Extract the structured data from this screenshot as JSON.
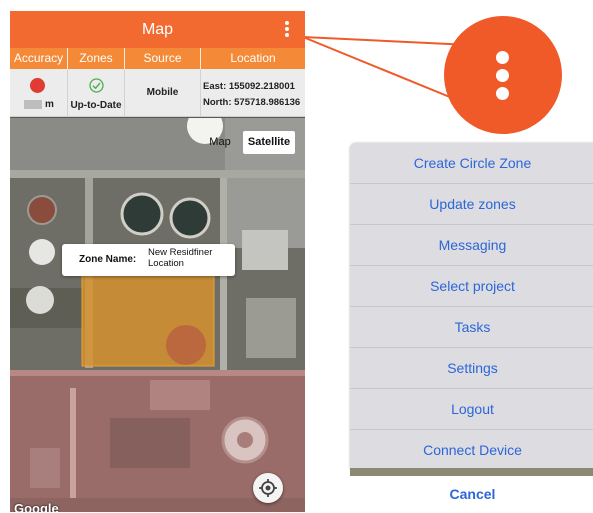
{
  "app": {
    "title": "Map"
  },
  "info": {
    "headers": [
      "Accuracy",
      "Zones",
      "Source",
      "Location"
    ],
    "accuracy_unit": "m",
    "zones_status": "Up-to-Date",
    "source": "Mobile",
    "east": "East: 155092.218001",
    "north": "North: 575718.986136"
  },
  "map": {
    "map_button": "Map",
    "satellite_button": "Satellite",
    "selected_type": "Satellite",
    "zone_label": "Zone Name:",
    "zone_name": "New Residfiner Location",
    "attribution": "Google"
  },
  "menu": {
    "items": [
      "Create Circle Zone",
      "Update zones",
      "Messaging",
      "Select project",
      "Tasks",
      "Settings",
      "Logout",
      "Connect Device"
    ],
    "cancel": "Cancel"
  },
  "colors": {
    "brand_orange": "#f26a30",
    "header_orange": "#f48a38",
    "accuracy_red": "#e23b33",
    "zone_green": "#4caf50",
    "ios_blue": "#2d66d8"
  }
}
